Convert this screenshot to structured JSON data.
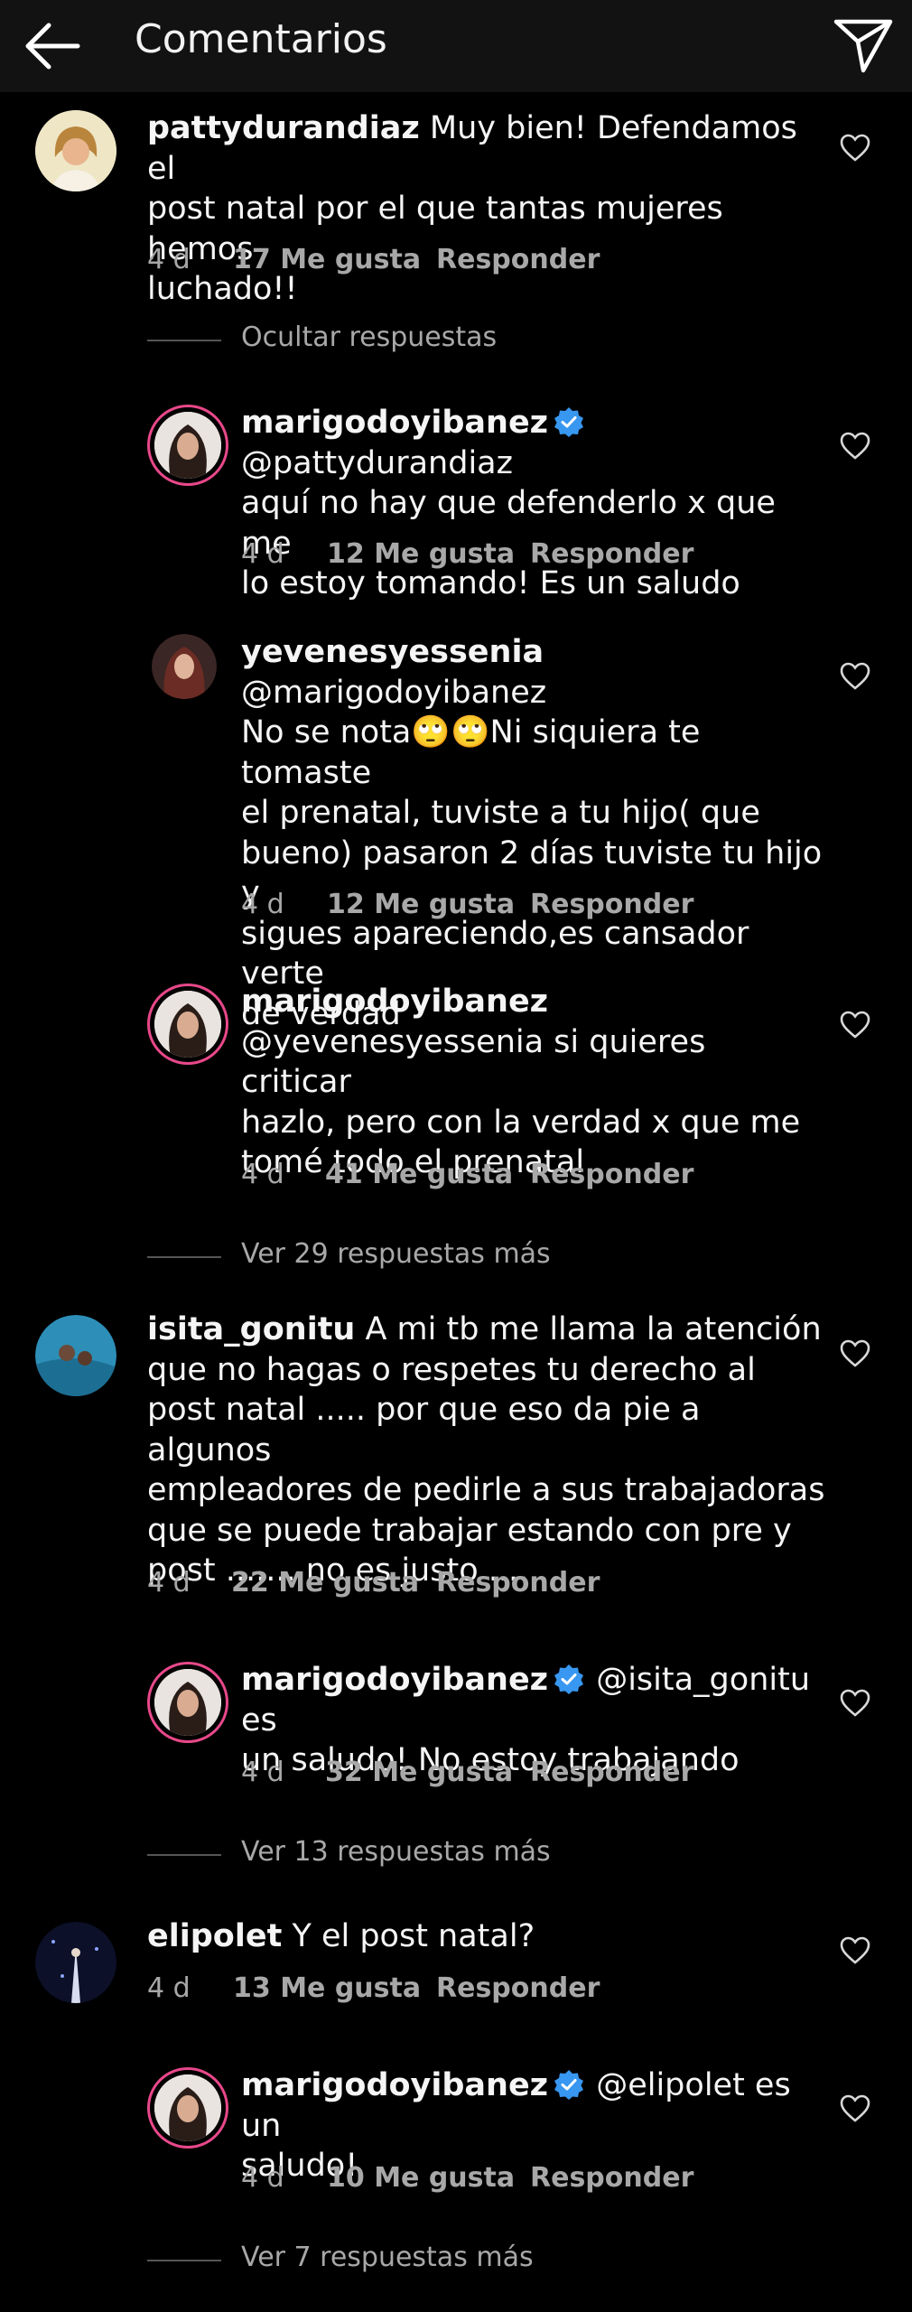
{
  "header": {
    "title": "Comentarios"
  },
  "thread_toggles": {
    "hide": "Ocultar respuestas",
    "more1": "Ver 29 respuestas más",
    "more2": "Ver 13 respuestas más",
    "more3": "Ver 7 respuestas más"
  },
  "comments": [
    {
      "username": "pattydurandiaz",
      "lines": [
        "Muy bien! Defendamos el",
        "post natal por el que tantas mujeres hemos",
        "luchado!!"
      ],
      "time": "4 d",
      "likes": "17 Me gusta",
      "reply": "Responder"
    },
    {
      "username": "marigodoyibanez",
      "verified": true,
      "lines": [
        "@pattydurandiaz",
        "aquí no hay que defenderlo x que me",
        "lo estoy tomando! Es un saludo"
      ],
      "time": "4 d",
      "likes": "12 Me gusta",
      "reply": "Responder"
    },
    {
      "username": "yevenesyessenia",
      "lines": [
        "@marigodoyibanez",
        "No se nota🙄🙄Ni siquiera te tomaste",
        "el prenatal, tuviste a tu hijo( que",
        "bueno) pasaron 2 días tuviste tu hijo y",
        "sigues apareciendo,es cansador verte",
        "de verdad"
      ],
      "time": "4 d",
      "likes": "12 Me gusta",
      "reply": "Responder"
    },
    {
      "username": "marigodoyibanez",
      "lines": [
        "",
        "@yevenesyessenia si quieres criticar",
        "hazlo, pero con la verdad x que me",
        "tomé todo el prenatal"
      ],
      "time": "4 d",
      "likes": "41 Me gusta",
      "reply": "Responder"
    },
    {
      "username": "isita_gonitu",
      "lines": [
        "A mi tb me llama la atención",
        "que no hagas o respetes tu derecho al",
        "post natal ..... por que eso da pie a algunos",
        "empleadores de pedirle a sus trabajadoras",
        "que se puede trabajar estando con pre y",
        "post ....... no es justo ....."
      ],
      "time": "4 d",
      "likes": "22 Me gusta",
      "reply": "Responder"
    },
    {
      "username": "marigodoyibanez",
      "verified": true,
      "lines": [
        "@isita_gonitu es",
        "un saludo! No estoy trabajando"
      ],
      "time": "4 d",
      "likes": "32 Me gusta",
      "reply": "Responder"
    },
    {
      "username": "elipolet",
      "lines": [
        "Y el post natal?"
      ],
      "time": "4 d",
      "likes": "13 Me gusta",
      "reply": "Responder"
    },
    {
      "username": "marigodoyibanez",
      "verified": true,
      "lines": [
        "@elipolet es un",
        "saludo!"
      ],
      "time": "4 d",
      "likes": "10 Me gusta",
      "reply": "Responder"
    }
  ],
  "colors": {
    "background": "#000000",
    "header": "#121212",
    "meta": "#a8a8a8",
    "verified": "#3897f0",
    "story_ring": "#e8488a"
  }
}
